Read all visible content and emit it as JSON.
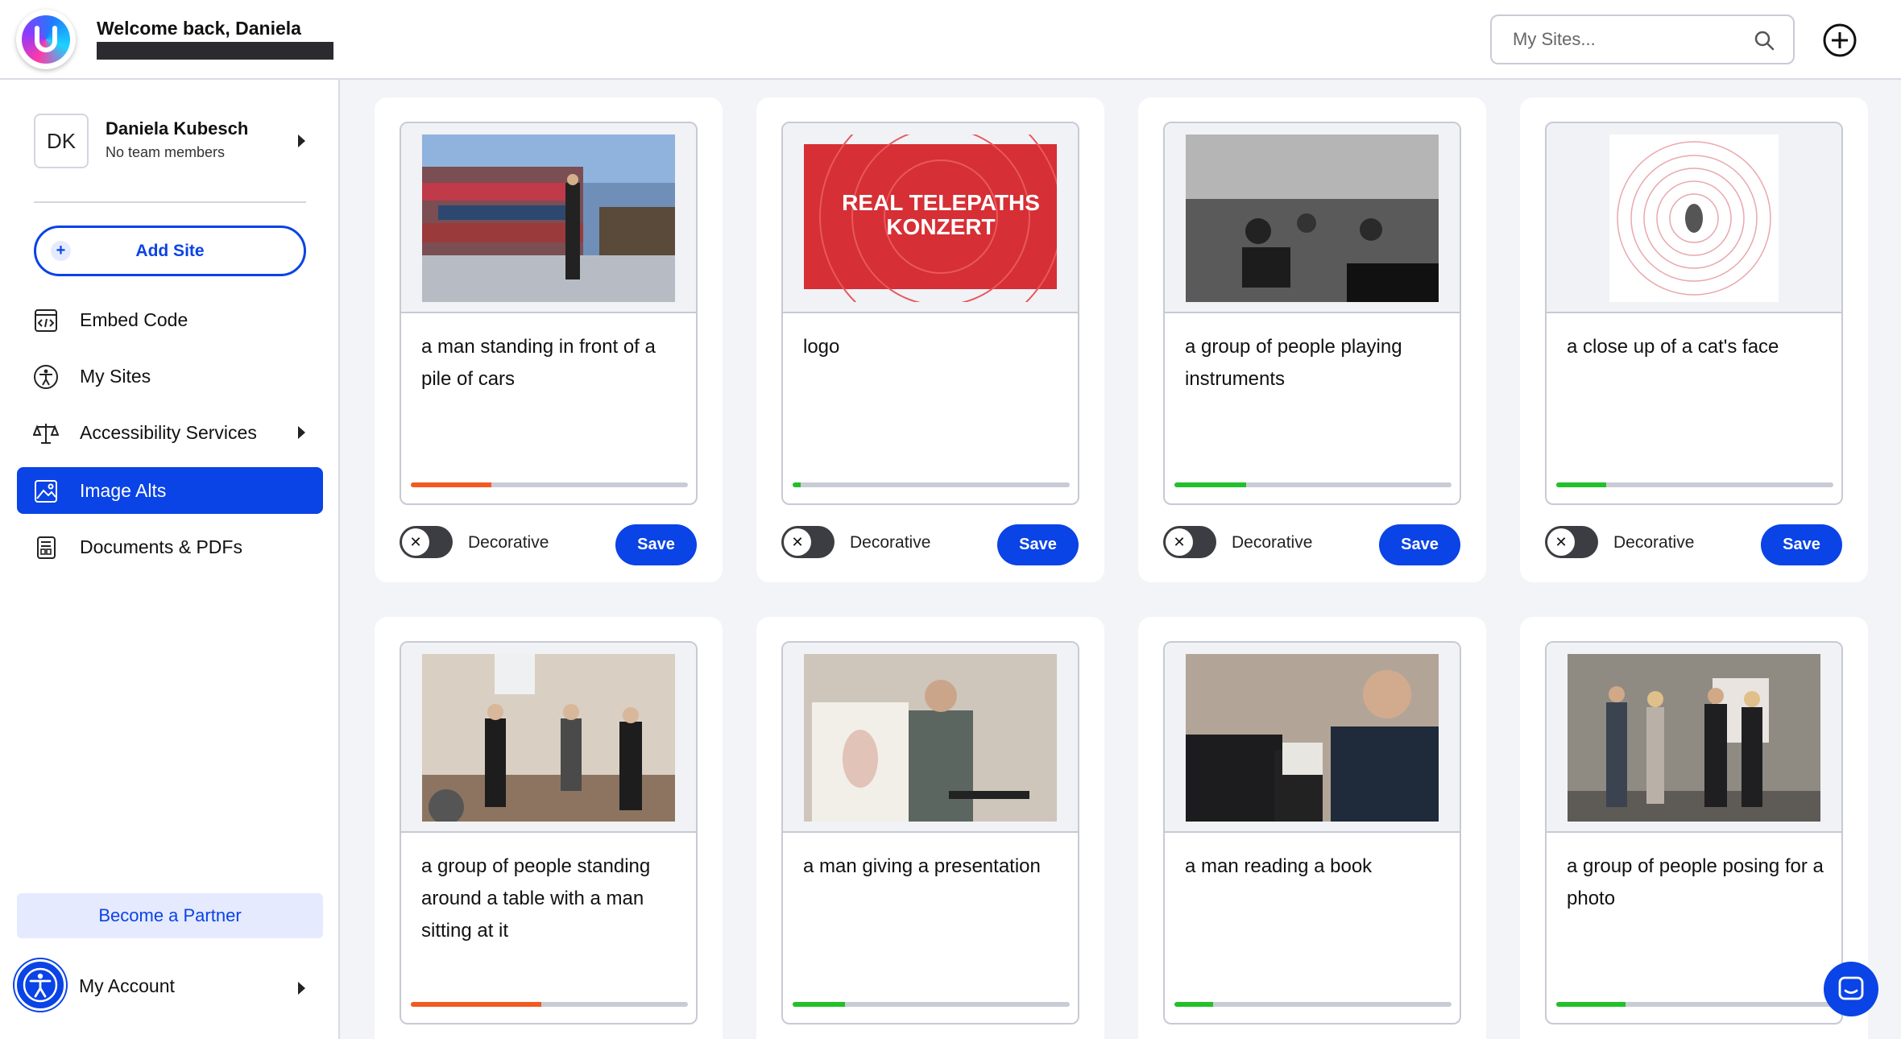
{
  "header": {
    "welcome": "Welcome back, Daniela",
    "search_placeholder": "My Sites..."
  },
  "sidebar": {
    "avatar_initials": "DK",
    "user_name": "Daniela Kubesch",
    "team_status": "No team members",
    "add_site_label": "Add Site",
    "nav": [
      {
        "label": "Embed Code",
        "icon": "code-icon"
      },
      {
        "label": "My Sites",
        "icon": "accessibility-person-icon"
      },
      {
        "label": "Accessibility Services",
        "icon": "scales-icon"
      },
      {
        "label": "Image Alts",
        "icon": "image-icon",
        "active": true
      },
      {
        "label": "Documents & PDFs",
        "icon": "document-icon"
      }
    ],
    "partner_label": "Become a Partner",
    "account_label": "My Account"
  },
  "cards": [
    {
      "alt": "a man standing in front of a pile of cars",
      "progress": 0.29,
      "bar_color": "#f25a22",
      "decorative_label": "Decorative",
      "save_label": "Save"
    },
    {
      "alt": "logo",
      "progress": 0.03,
      "bar_color": "#22c02a",
      "decorative_label": "Decorative",
      "save_label": "Save",
      "logo_text_1": "REAL TELEPATHS",
      "logo_text_2": "KONZERT"
    },
    {
      "alt": "a group of people playing instruments",
      "progress": 0.26,
      "bar_color": "#22c02a",
      "decorative_label": "Decorative",
      "save_label": "Save"
    },
    {
      "alt": "a close up of a cat's face",
      "progress": 0.18,
      "bar_color": "#22c02a",
      "decorative_label": "Decorative",
      "save_label": "Save"
    },
    {
      "alt": "a group of people standing around a table with a man sitting at it",
      "progress": 0.47,
      "bar_color": "#f25a22",
      "decorative_label": "Decorative",
      "save_label": "Save"
    },
    {
      "alt": "a man giving a presentation",
      "progress": 0.19,
      "bar_color": "#22c02a",
      "decorative_label": "Decorative",
      "save_label": "Save"
    },
    {
      "alt": "a man reading a book",
      "progress": 0.14,
      "bar_color": "#22c02a",
      "decorative_label": "Decorative",
      "save_label": "Save"
    },
    {
      "alt": "a group of people posing for a photo",
      "progress": 0.25,
      "bar_color": "#22c02a",
      "decorative_label": "Decorative",
      "save_label": "Save"
    }
  ],
  "colors": {
    "accent": "#0a43e6",
    "progress_bad": "#f25a22",
    "progress_good": "#22c02a"
  }
}
